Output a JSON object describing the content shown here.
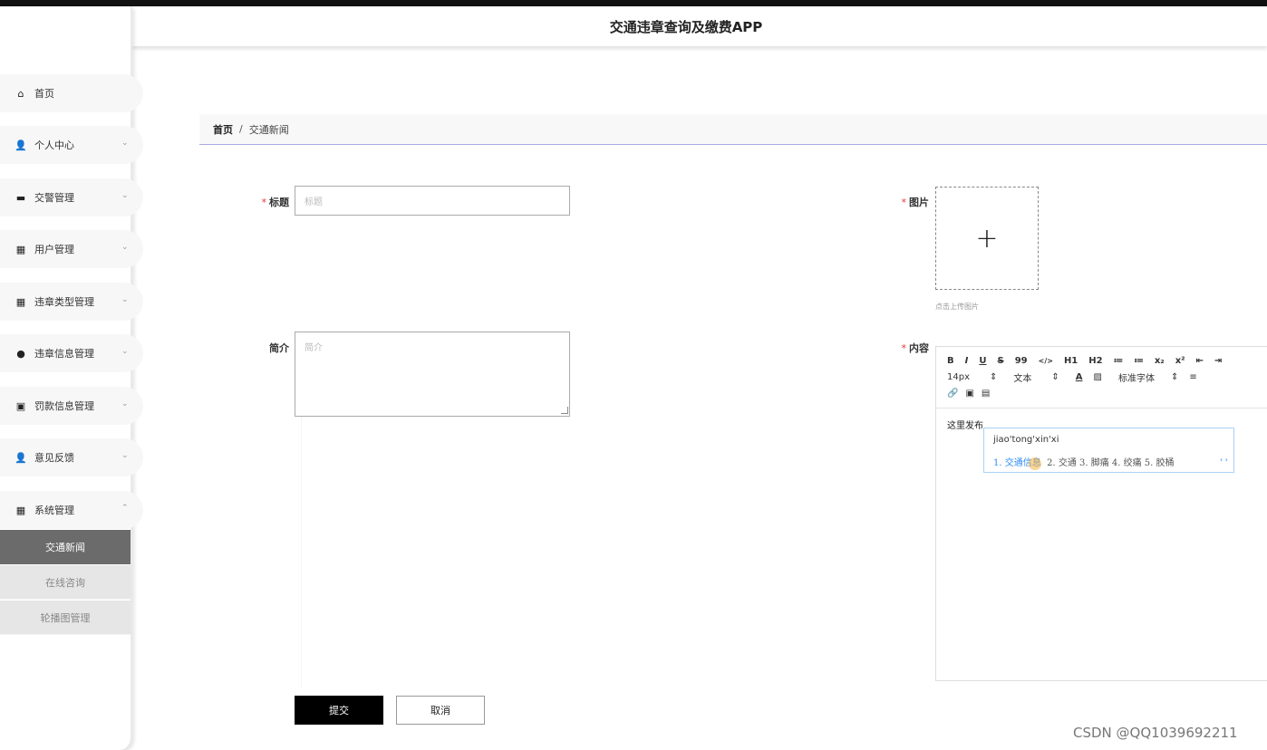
{
  "app": {
    "title": "交通违章查询及缴费APP"
  },
  "sidebar": {
    "items": [
      {
        "label": "首页",
        "icon": "home-icon",
        "glyph": "⌂",
        "has_chevron": false
      },
      {
        "label": "个人中心",
        "icon": "user-icon",
        "glyph": "👤",
        "has_chevron": true,
        "chevron": "⌄"
      },
      {
        "label": "交警管理",
        "icon": "briefcase-icon",
        "glyph": "▬",
        "has_chevron": true,
        "chevron": "⌄"
      },
      {
        "label": "用户管理",
        "icon": "grid-icon",
        "glyph": "▦",
        "has_chevron": true,
        "chevron": "⌄"
      },
      {
        "label": "违章类型管理",
        "icon": "table-icon",
        "glyph": "▦",
        "has_chevron": true,
        "chevron": "⌄"
      },
      {
        "label": "违章信息管理",
        "icon": "map-pin-icon",
        "glyph": "●",
        "has_chevron": true,
        "chevron": "⌄"
      },
      {
        "label": "罚款信息管理",
        "icon": "clipboard-icon",
        "glyph": "▣",
        "has_chevron": true,
        "chevron": "⌄"
      },
      {
        "label": "意见反馈",
        "icon": "user-icon",
        "glyph": "👤",
        "has_chevron": true,
        "chevron": "⌄"
      },
      {
        "label": "系统管理",
        "icon": "grid-icon",
        "glyph": "▦",
        "has_chevron": true,
        "chevron": "⌃"
      }
    ],
    "sub_items": [
      {
        "label": "交通新闻",
        "active": true
      },
      {
        "label": "在线咨询",
        "active": false
      },
      {
        "label": "轮播图管理",
        "active": false
      }
    ]
  },
  "breadcrumb": {
    "home": "首页",
    "separator": "/",
    "current": "交通新闻"
  },
  "form": {
    "required_mark": "*",
    "title": {
      "label": "标题",
      "placeholder": "标题",
      "value": ""
    },
    "summary": {
      "label": "简介",
      "placeholder": "简介",
      "value": ""
    },
    "image": {
      "label": "图片",
      "upload_glyph": "+",
      "hint": "点击上传图片"
    },
    "content": {
      "label": "内容",
      "text": "这里发布"
    }
  },
  "editor": {
    "toolbar_row1": [
      "B",
      "I",
      "U",
      "S",
      "99",
      "</>",
      "H1",
      "H2",
      "≔",
      "≔",
      "x₂",
      "x²",
      "⇤",
      "⇥"
    ],
    "toolbar_row2": [
      "14px",
      "⇕",
      "文本",
      "⇕",
      "A",
      "▨",
      "标准字体",
      "⇕",
      "≡"
    ],
    "toolbar_row3": [
      "🔗",
      "▣",
      "▤"
    ]
  },
  "ime": {
    "pinyin": "jiao'tong'xin'xi",
    "candidate_1": "1. 交通信息",
    "candidates_rest": "2. 交通  3. 脚痛  4. 绞痛  5. 胶桶",
    "arrows": "‹ ›"
  },
  "buttons": {
    "submit": "提交",
    "cancel": "取消"
  },
  "watermark": "CSDN @QQ1039692211"
}
